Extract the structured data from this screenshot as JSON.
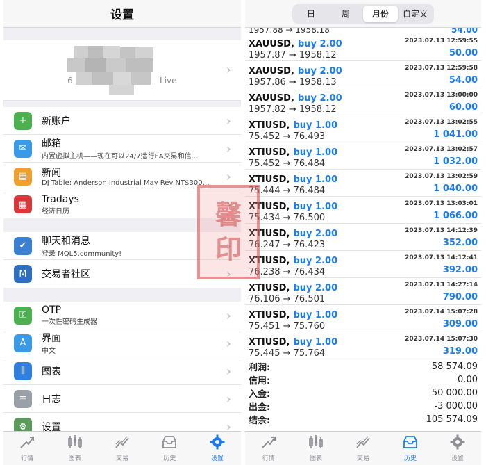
{
  "left": {
    "title": "设置",
    "account": {
      "suffix": "Live",
      "prefix_fragment": "6"
    },
    "groups": [
      [
        {
          "name": "new-account",
          "title": "新账户",
          "subtitle": "",
          "icon": "user-add-icon",
          "color": "#4caf50",
          "glyph": "+"
        },
        {
          "name": "mailbox",
          "title": "邮箱",
          "subtitle": "内置虚拟主机——现在可以24/7运行EA交易和信…",
          "icon": "mail-icon",
          "color": "#3a9ae8",
          "glyph": "✉"
        },
        {
          "name": "news",
          "title": "新闻",
          "subtitle": "DJ Table: Anderson Industrial May Rev NT$300…",
          "icon": "news-icon",
          "color": "#f0a030",
          "glyph": "▤"
        },
        {
          "name": "tradays",
          "title": "Tradays",
          "subtitle": "经济日历",
          "icon": "calendar-icon",
          "color": "#d9383a",
          "glyph": "▦"
        }
      ],
      [
        {
          "name": "chat",
          "title": "聊天和消息",
          "subtitle": "登录 MQL5.community!",
          "icon": "thumbs-up-icon",
          "color": "#3a7fd0",
          "glyph": "✔"
        },
        {
          "name": "community",
          "title": "交易者社区",
          "subtitle": "",
          "icon": "mql5-icon",
          "color": "#2f6fc0",
          "glyph": "M"
        }
      ],
      [
        {
          "name": "otp",
          "title": "OTP",
          "subtitle": "一次性密码生成器",
          "icon": "key-icon",
          "color": "#4caf50",
          "glyph": "⚿"
        },
        {
          "name": "interface",
          "title": "界面",
          "subtitle": "中文",
          "icon": "language-icon",
          "color": "#3a9ae8",
          "glyph": "A"
        },
        {
          "name": "charts",
          "title": "图表",
          "subtitle": "",
          "icon": "candlestick-icon",
          "color": "#2f7fe0",
          "glyph": "⫼"
        },
        {
          "name": "journal",
          "title": "日志",
          "subtitle": "",
          "icon": "journal-icon",
          "color": "#9aa0a8",
          "glyph": "≡"
        },
        {
          "name": "settings",
          "title": "设置",
          "subtitle": "",
          "icon": "settings-app-icon",
          "color": "#5a9a5a",
          "glyph": "⚙"
        }
      ]
    ],
    "tabs": [
      {
        "label": "行情",
        "icon": "quotes-icon",
        "active": false
      },
      {
        "label": "图表",
        "icon": "chart-icon",
        "active": false
      },
      {
        "label": "交易",
        "icon": "trade-icon",
        "active": false
      },
      {
        "label": "历史",
        "icon": "history-icon",
        "active": false
      },
      {
        "label": "设置",
        "icon": "gear-icon",
        "active": true
      }
    ]
  },
  "right": {
    "segments": [
      {
        "label": "日",
        "active": false
      },
      {
        "label": "周",
        "active": false
      },
      {
        "label": "月份",
        "active": true
      },
      {
        "label": "自定义",
        "active": false
      }
    ],
    "cut_row": {
      "prices": "1957.88 → 1958.18",
      "profit": "54.00"
    },
    "trades": [
      {
        "symbol": "XAUUSD,",
        "side": "buy 2.00",
        "date": "2023.07.13 12:59:55",
        "prices": "1957.87 → 1958.12",
        "profit": "50.00"
      },
      {
        "symbol": "XAUUSD,",
        "side": "buy 2.00",
        "date": "2023.07.13 12:59:58",
        "prices": "1957.86 → 1958.13",
        "profit": "54.00"
      },
      {
        "symbol": "XAUUSD,",
        "side": "buy 2.00",
        "date": "2023.07.13 13:00:00",
        "prices": "1957.82 → 1958.12",
        "profit": "60.00"
      },
      {
        "symbol": "XTIUSD,",
        "side": "buy 1.00",
        "date": "2023.07.13 13:02:55",
        "prices": "75.452 → 76.493",
        "profit": "1 041.00"
      },
      {
        "symbol": "XTIUSD,",
        "side": "buy 1.00",
        "date": "2023.07.13 13:02:57",
        "prices": "75.452 → 76.484",
        "profit": "1 032.00"
      },
      {
        "symbol": "XTIUSD,",
        "side": "buy 1.00",
        "date": "2023.07.13 13:02:59",
        "prices": "75.444 → 76.484",
        "profit": "1 040.00"
      },
      {
        "symbol": "XTIUSD,",
        "side": "buy 1.00",
        "date": "2023.07.13 13:03:01",
        "prices": "75.434 → 76.500",
        "profit": "1 066.00"
      },
      {
        "symbol": "XTIUSD,",
        "side": "buy 2.00",
        "date": "2023.07.13 14:12:39",
        "prices": "76.247 → 76.423",
        "profit": "352.00"
      },
      {
        "symbol": "XTIUSD,",
        "side": "buy 2.00",
        "date": "2023.07.13 14:12:41",
        "prices": "76.238 → 76.434",
        "profit": "392.00"
      },
      {
        "symbol": "XTIUSD,",
        "side": "buy 2.00",
        "date": "2023.07.13 14:27:14",
        "prices": "76.106 → 76.501",
        "profit": "790.00"
      },
      {
        "symbol": "XTIUSD,",
        "side": "buy 1.00",
        "date": "2023.07.14 15:07:28",
        "prices": "75.451 → 75.760",
        "profit": "309.00"
      },
      {
        "symbol": "XTIUSD,",
        "side": "buy 1.00",
        "date": "2023.07.14 15:07:30",
        "prices": "75.445 → 75.764",
        "profit": "319.00"
      }
    ],
    "summary": [
      {
        "label": "利润:",
        "value": "58 574.09"
      },
      {
        "label": "信用:",
        "value": "0.00"
      },
      {
        "label": "入金:",
        "value": "50 000.00"
      },
      {
        "label": "出金:",
        "value": "-3 000.00"
      },
      {
        "label": "结余:",
        "value": "105 574.09"
      }
    ],
    "tabs": [
      {
        "label": "行情",
        "icon": "quotes-icon",
        "active": false
      },
      {
        "label": "图表",
        "icon": "chart-icon",
        "active": false
      },
      {
        "label": "交易",
        "icon": "trade-icon",
        "active": false
      },
      {
        "label": "历史",
        "icon": "history-icon",
        "active": true
      },
      {
        "label": "设置",
        "icon": "gear-icon",
        "active": false
      }
    ]
  },
  "watermark": {
    "chars": [
      "馨",
      "印"
    ]
  },
  "colors": {
    "accent": "#1a7cf4",
    "inactive": "#8e8e93"
  }
}
